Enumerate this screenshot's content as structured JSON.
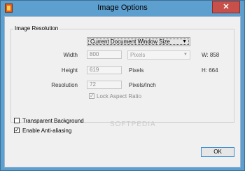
{
  "window": {
    "title": "Image Options",
    "close_symbol": "✕"
  },
  "group": {
    "label": "Image Resolution"
  },
  "size_dropdown": {
    "value": "Current Document Window Size",
    "arrow": "▼"
  },
  "width": {
    "label": "Width",
    "value": "800",
    "unit": "Pixels",
    "unit_arrow": "▼",
    "readout": "W: 858"
  },
  "height": {
    "label": "Height",
    "value": "619",
    "unit": "Pixels",
    "readout": "H: 664"
  },
  "resolution": {
    "label": "Resolution",
    "value": "72",
    "unit": "Pixels/Inch"
  },
  "lock_aspect": {
    "label": "Lock Aspect Ratio",
    "checked": true,
    "check_symbol": "✓"
  },
  "transparent_bg": {
    "label": "Transparent Background",
    "checked": false
  },
  "anti_alias": {
    "label": "Enable Anti-aliasing",
    "checked": true,
    "check_symbol": "✓"
  },
  "ok_button": {
    "label": "OK"
  },
  "watermark": {
    "text": "SOFTPEDIA"
  }
}
